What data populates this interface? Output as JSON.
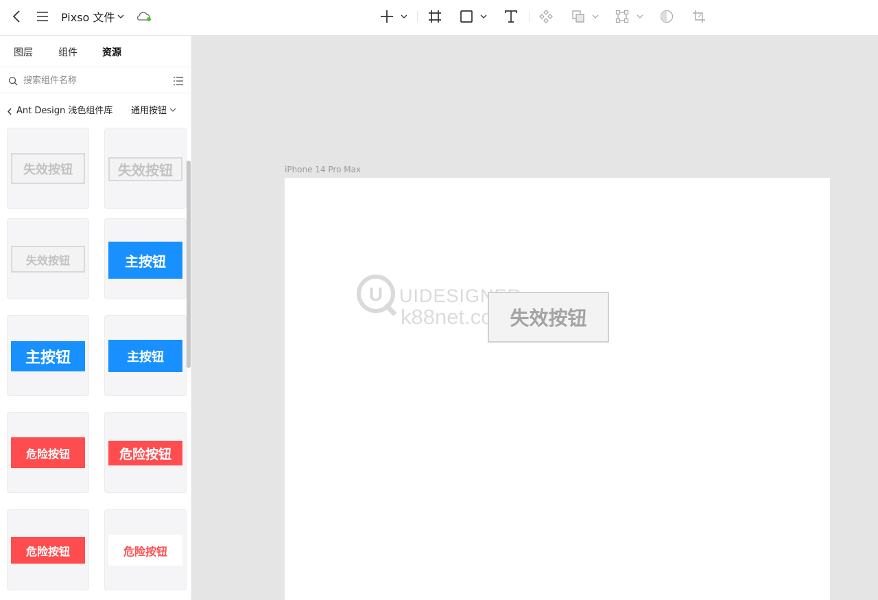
{
  "topbar": {
    "file_title": "Pixso 文件"
  },
  "left_panel": {
    "tabs": [
      {
        "label": "图层"
      },
      {
        "label": "组件"
      },
      {
        "label": "资源"
      }
    ],
    "active_tab": "资源",
    "search": {
      "placeholder": "搜索组件名称",
      "value": ""
    },
    "library": {
      "name": "Ant Design 浅色组件库",
      "category": "通用按钮"
    },
    "components": [
      {
        "label": "失效按钮",
        "variant": "disabled"
      },
      {
        "label": "失效按钮",
        "variant": "disabled"
      },
      {
        "label": "失效按钮",
        "variant": "disabled"
      },
      {
        "label": "主按钮",
        "variant": "primary"
      },
      {
        "label": "主按钮",
        "variant": "primary"
      },
      {
        "label": "主按钮",
        "variant": "primary"
      },
      {
        "label": "危险按钮",
        "variant": "danger"
      },
      {
        "label": "危险按钮",
        "variant": "danger"
      },
      {
        "label": "危险按钮",
        "variant": "danger"
      },
      {
        "label": "危险按钮",
        "variant": "danger-white"
      }
    ]
  },
  "canvas": {
    "frame_label": "iPhone 14 Pro Max",
    "button_label": "失效按钮",
    "watermark": {
      "line1": "UIDESIGNER",
      "line2": "k88net.com",
      "logo_letter": "U"
    }
  },
  "colors": {
    "primary": "#1890ff",
    "danger": "#ff4d4f",
    "online_dot": "#52c41a",
    "canvas_bg": "#e5e5e5"
  },
  "icons": [
    "back-icon",
    "menu-icon",
    "chevron-down-icon",
    "cloud-sync-icon",
    "add-icon",
    "frame-icon",
    "rectangle-icon",
    "text-icon",
    "component-icon",
    "boolean-icon",
    "vector-network-icon",
    "mask-icon",
    "crop-icon",
    "search-icon",
    "list-view-icon"
  ]
}
